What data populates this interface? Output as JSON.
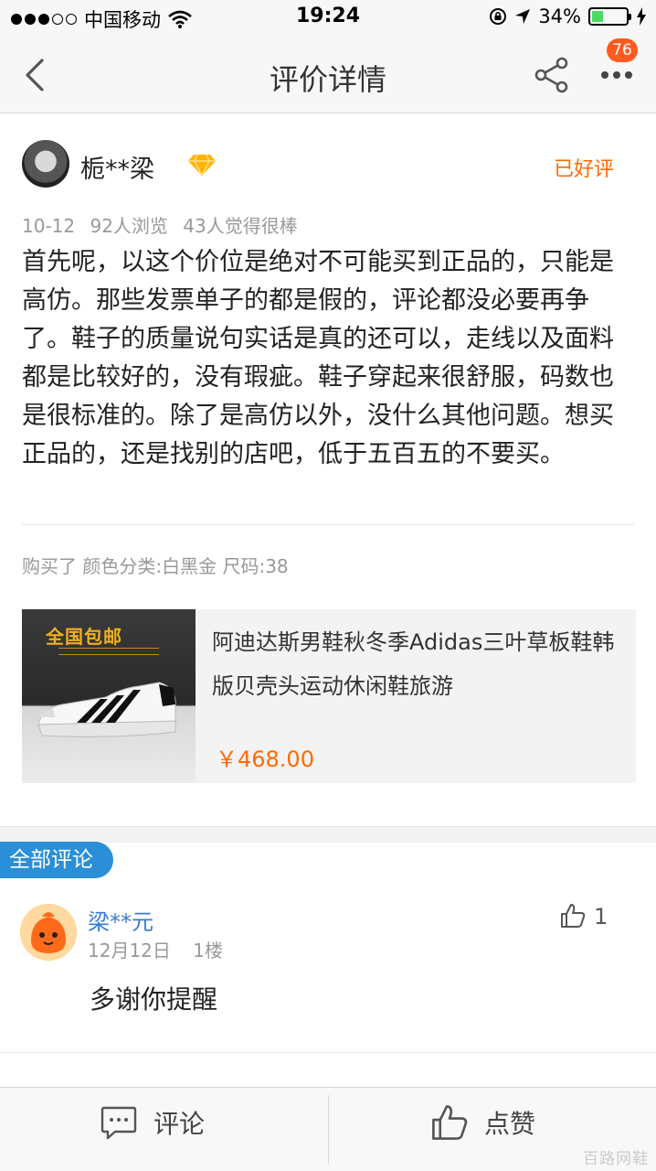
{
  "status_bar": {
    "carrier": "中国移动",
    "time": "19:24",
    "battery": "34%",
    "battery_level": 0.34
  },
  "nav": {
    "title": "评价详情",
    "badge_count": "76"
  },
  "review": {
    "username": "栀**梁",
    "status": "已好评",
    "date": "10-12",
    "views": "92人浏览",
    "likes": "43人觉得很棒",
    "text": "首先呢，以这个价位是绝对不可能买到正品的，只能是高仿。那些发票单子的都是假的，评论都没必要再争了。鞋子的质量说句实话是真的还可以，走线以及面料都是比较好的，没有瑕疵。鞋子穿起来很舒服，码数也是很标准的。除了是高仿以外，没什么其他问题。想买正品的，还是找别的店吧，低于五百五的不要买。",
    "sku": "购买了 颜色分类:白黑金 尺码:38"
  },
  "product": {
    "promo": "全国包邮",
    "title": "阿迪达斯男鞋秋冬季Adidas三叶草板鞋韩版贝壳头运动休闲鞋旅游",
    "price": "￥468.00"
  },
  "comments_section": {
    "label": "全部评论"
  },
  "comment": {
    "username": "梁**元",
    "date": "12月12日",
    "floor": "1楼",
    "like_count": "1",
    "text": "多谢你提醒"
  },
  "bottom_bar": {
    "comment_label": "评论",
    "like_label": "点赞"
  },
  "watermark": "百路网鞋",
  "colors": {
    "accent_orange": "#ff6a00",
    "link_blue": "#3a7bd5",
    "tag_blue": "#2a8fd8",
    "badge_red": "#ff5a1f"
  }
}
